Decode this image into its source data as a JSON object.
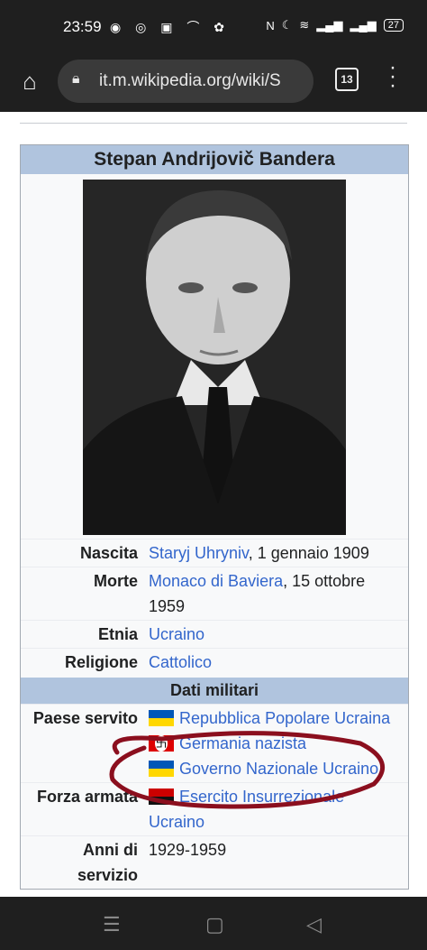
{
  "status": {
    "time": "23:59",
    "battery": "27"
  },
  "browser": {
    "url": "it.m.wikipedia.org/wiki/S",
    "tab_count": "13"
  },
  "infobox": {
    "title": "Stepan Andrijovič Bandera",
    "rows": [
      {
        "label": "Nascita",
        "link": "Staryj Uhryniv",
        "text": ", 1 gennaio 1909"
      },
      {
        "label": "Morte",
        "link": "Monaco di Baviera",
        "text": ", 15 ottobre 1959"
      },
      {
        "label": "Etnia",
        "link": "Ucraino",
        "text": ""
      },
      {
        "label": "Religione",
        "link": "Cattolico",
        "text": ""
      }
    ],
    "military_header": "Dati militari",
    "served": {
      "label": "Paese servito",
      "items": [
        "Repubblica Popolare Ucraina",
        "Germania nazista",
        "Governo Nazionale Ucraino"
      ]
    },
    "force": {
      "label": "Forza armata",
      "link": "Esercito Insurrezionale Ucraino"
    },
    "years": {
      "label": "Anni di servizio",
      "text": "1929-1959"
    }
  },
  "icons": {
    "home": "home-icon",
    "lock": "lock-icon",
    "menu": "more-vert-icon"
  },
  "colors": {
    "header": "#b0c4de",
    "link": "#3366cc",
    "annotation": "#8b0f1e"
  }
}
